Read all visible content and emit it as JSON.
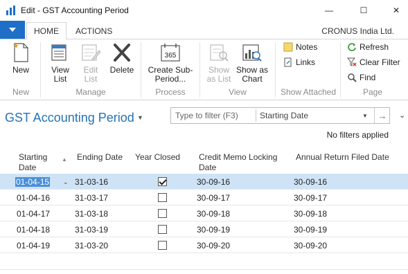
{
  "window": {
    "title": "Edit - GST Accounting Period",
    "minimize_glyph": "—",
    "maximize_glyph": "☐",
    "close_glyph": "✕"
  },
  "ribbon": {
    "tabs": [
      {
        "label": "HOME",
        "active": true
      },
      {
        "label": "ACTIONS",
        "active": false
      }
    ],
    "company": "CRONUS India Ltd.",
    "groups": {
      "new": "New",
      "manage": "Manage",
      "process": "Process",
      "view": "View",
      "show_attached": "Show Attached",
      "page": "Page"
    },
    "buttons": {
      "new": "New",
      "view_list_1": "View",
      "view_list_2": "List",
      "edit_list_1": "Edit",
      "edit_list_2": "List",
      "delete": "Delete",
      "create_sub_1": "Create Sub-",
      "create_sub_2": "Period...",
      "create_icon_text": "365",
      "show_as_list_1": "Show",
      "show_as_list_2": "as List",
      "show_as_chart_1": "Show as",
      "show_as_chart_2": "Chart",
      "notes": "Notes",
      "links": "Links",
      "refresh": "Refresh",
      "clear_filter": "Clear Filter",
      "find": "Find"
    }
  },
  "page": {
    "title": "GST Accounting Period",
    "filter_placeholder": "Type to filter (F3)",
    "filter_field": "Starting Date",
    "filter_status": "No filters applied"
  },
  "grid": {
    "columns": {
      "starting_date_1": "Starting",
      "starting_date_2": "Date",
      "ending_date": "Ending Date",
      "year_closed": "Year Closed",
      "credit_memo_1": "Credit Memo Locking",
      "credit_memo_2": "Date",
      "annual_return": "Annual Return Filed Date"
    },
    "rows": [
      {
        "starting": "01-04-15",
        "ending": "31-03-16",
        "closed": true,
        "credit": "30-09-16",
        "annual": "30-09-16"
      },
      {
        "starting": "01-04-16",
        "ending": "31-03-17",
        "closed": false,
        "credit": "30-09-17",
        "annual": "30-09-17"
      },
      {
        "starting": "01-04-17",
        "ending": "31-03-18",
        "closed": false,
        "credit": "30-09-18",
        "annual": "30-09-18"
      },
      {
        "starting": "01-04-18",
        "ending": "31-03-19",
        "closed": false,
        "credit": "30-09-19",
        "annual": "30-09-19"
      },
      {
        "starting": "01-04-19",
        "ending": "31-03-20",
        "closed": false,
        "credit": "30-09-20",
        "annual": "30-09-20"
      }
    ]
  },
  "colors": {
    "accent": "#2572b4",
    "file_menu": "#1e6fc8",
    "selected_row": "#cfe3f6"
  }
}
